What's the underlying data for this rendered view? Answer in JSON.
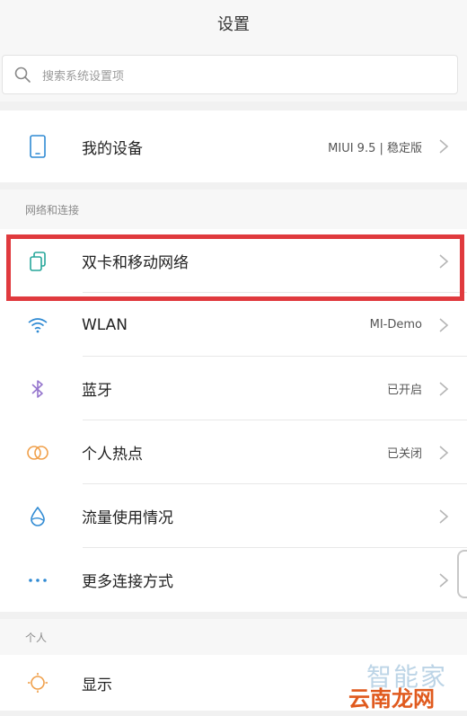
{
  "header": {
    "title": "设置"
  },
  "search": {
    "placeholder": "搜索系统设置项"
  },
  "device": {
    "label": "我的设备",
    "value": "MIUI 9.5 | 稳定版"
  },
  "sections": {
    "network": "网络和连接",
    "personal": "个人"
  },
  "network_items": [
    {
      "label": "双卡和移动网络",
      "value": ""
    },
    {
      "label": "WLAN",
      "value": "MI-Demo"
    },
    {
      "label": "蓝牙",
      "value": "已开启"
    },
    {
      "label": "个人热点",
      "value": "已关闭"
    },
    {
      "label": "流量使用情况",
      "value": ""
    },
    {
      "label": "更多连接方式",
      "value": ""
    }
  ],
  "personal_items": [
    {
      "label": "显示"
    }
  ],
  "watermark": {
    "top": "智能家",
    "bottom": "云南龙网"
  },
  "colors": {
    "highlight": "#e03a3e",
    "icon_blue": "#2f8ad3",
    "icon_green": "#26a69a",
    "icon_purple": "#9575cd",
    "icon_orange": "#f0a04b"
  }
}
